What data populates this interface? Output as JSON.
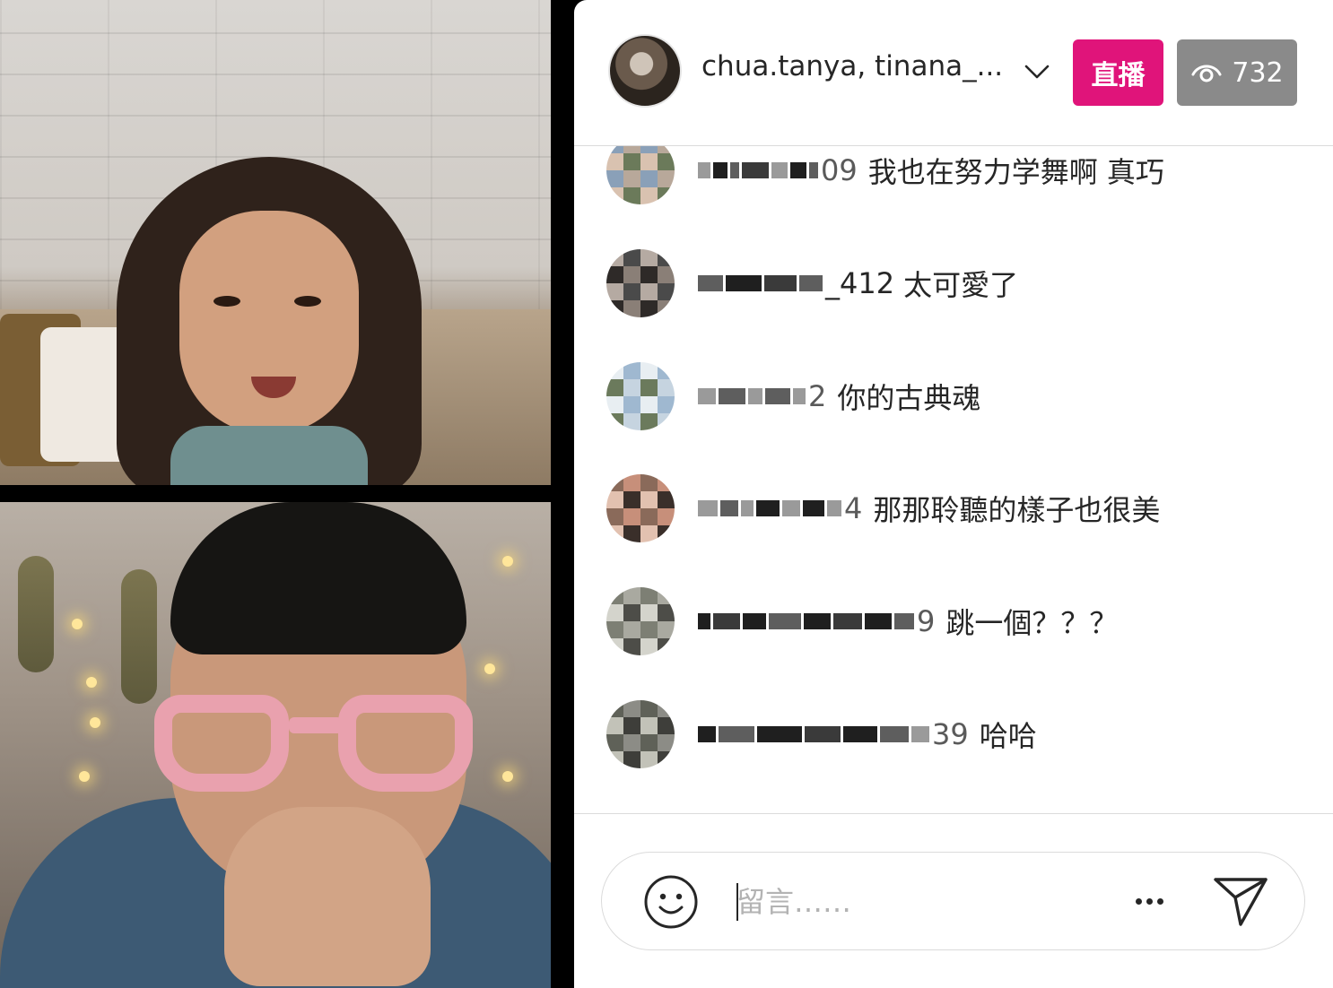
{
  "header": {
    "host_names": "chua.tanya, tinana_...",
    "live_label": "直播",
    "viewer_count": "732"
  },
  "comments": [
    {
      "user_tail": "09",
      "message": "我也在努力学舞啊 真巧",
      "avatar_colors": [
        "#b8a89a",
        "#6b7a5a",
        "#d9c2b0",
        "#8aa0b8"
      ]
    },
    {
      "user_tail": "_412",
      "message": "太可愛了",
      "avatar_colors": [
        "#4a4a4a",
        "#8a7f77",
        "#2e2a28",
        "#b5aaa2"
      ]
    },
    {
      "user_tail": "2",
      "message": "你的古典魂",
      "avatar_colors": [
        "#9fb8d0",
        "#c6d4e0",
        "#6b7a5c",
        "#e8eef2"
      ]
    },
    {
      "user_tail": "4",
      "message": "那那聆聽的樣子也很美",
      "avatar_colors": [
        "#c78f7a",
        "#3a2f2a",
        "#e2c1b0",
        "#8a6a5a"
      ]
    },
    {
      "user_tail": "9",
      "message": "跳一個？？？",
      "avatar_colors": [
        "#a9a9a0",
        "#4d4d48",
        "#d4d4cc",
        "#7d7f74"
      ]
    },
    {
      "user_tail": "39",
      "message": "哈哈",
      "avatar_colors": [
        "#8c8c86",
        "#3e3e3a",
        "#c2c2b8",
        "#5f6158"
      ]
    }
  ],
  "composer": {
    "placeholder": "留言……"
  },
  "icons": {
    "chevron": "chevron-down-icon",
    "eye": "eye-icon",
    "emoji": "smiley-icon",
    "more": "more-horizontal-icon",
    "send": "send-icon"
  },
  "colors": {
    "live_badge": "#e0147a",
    "viewer_badge": "#8a8a8a"
  }
}
